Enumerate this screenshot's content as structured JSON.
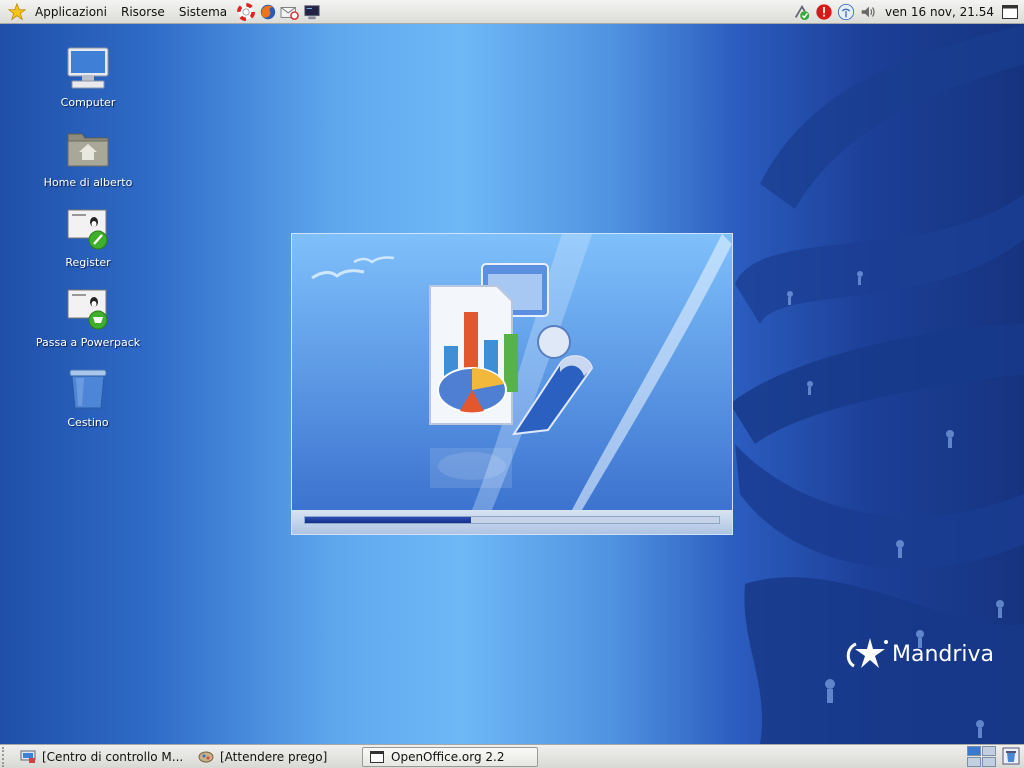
{
  "top_panel": {
    "menus": [
      "Applicazioni",
      "Risorse",
      "Sistema"
    ],
    "launchers": [
      "help-lifebuoy-icon",
      "firefox-icon",
      "mail-icon",
      "terminal-icon"
    ],
    "tray_icons": [
      "network-ok-icon",
      "update-alert-icon",
      "wireless-icon",
      "volume-icon"
    ],
    "clock": "ven 16 nov, 21.54"
  },
  "desktop": {
    "icons": [
      {
        "label": "Computer",
        "icon": "computer-icon"
      },
      {
        "label": "Home di alberto",
        "icon": "home-folder-icon"
      },
      {
        "label": "Register",
        "icon": "register-icon"
      },
      {
        "label": "Passa a Powerpack",
        "icon": "powerpack-icon"
      },
      {
        "label": "Cestino",
        "icon": "trash-icon"
      }
    ]
  },
  "splash": {
    "progress_fraction": 0.4
  },
  "brand": {
    "name": "Mandriva"
  },
  "taskbar": {
    "tasks": [
      {
        "label": "[Centro di controllo M...",
        "icon": "control-center-icon",
        "active": false
      },
      {
        "label": "[Attendere prego]",
        "icon": "wait-icon",
        "active": false
      },
      {
        "label": "OpenOffice.org 2.2",
        "icon": "window-icon",
        "active": true
      }
    ],
    "workspaces": 4,
    "current_workspace": 0
  },
  "colors": {
    "desktop_blue": "#2f6cc8",
    "progress": "#13308a",
    "panel": "#e4e4e0"
  }
}
